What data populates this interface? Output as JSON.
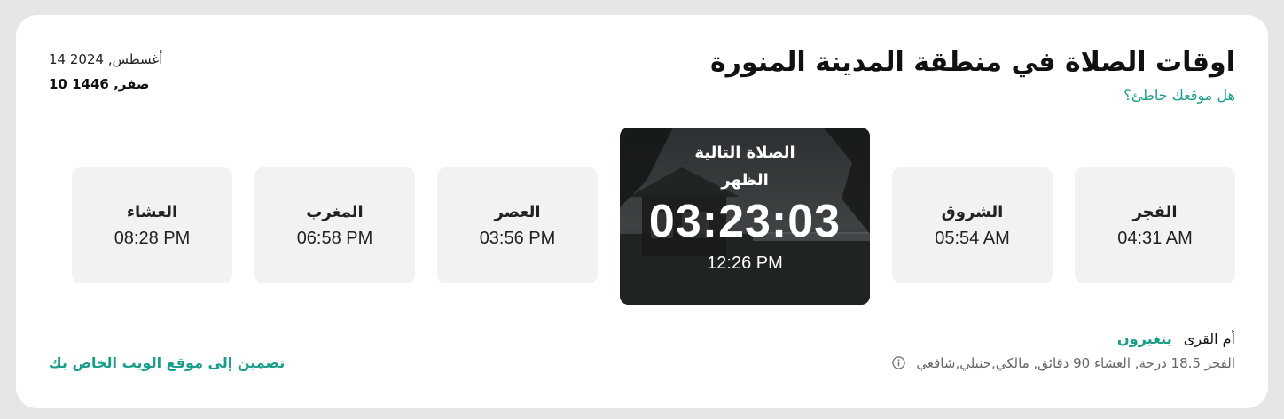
{
  "header": {
    "title": "اوقات الصلاة في منطقة المدينة المنورة",
    "wrong_location": "هل موقعك خاطئ؟",
    "gregorian_date": "14 أغسطس, 2024",
    "hijri_date": "10 صفر, 1446"
  },
  "prayers": [
    {
      "name": "الفجر",
      "time": "04:31 AM"
    },
    {
      "name": "الشروق",
      "time": "05:54 AM"
    },
    {
      "name": "العصر",
      "time": "03:56 PM"
    },
    {
      "name": "المغرب",
      "time": "06:58 PM"
    },
    {
      "name": "العشاء",
      "time": "08:28 PM"
    }
  ],
  "next_prayer": {
    "label": "الصلاة التالية",
    "name": "الظهر",
    "countdown": "03:23:03",
    "time": "12:26 PM"
  },
  "method": {
    "name": "أم القرى",
    "change_label": "يتغيرون",
    "details": "الفجر 18.5 درجة, العشاء 90 دقائق, مالكي,حنبلي,شافعي",
    "info_icon": "info-circle-icon"
  },
  "embed_link": "تضمين إلى موقع الويب الخاص بك",
  "colors": {
    "accent": "#1a9e8a",
    "card_bg": "#f2f2f2",
    "page_bg": "#e6e6e6"
  }
}
